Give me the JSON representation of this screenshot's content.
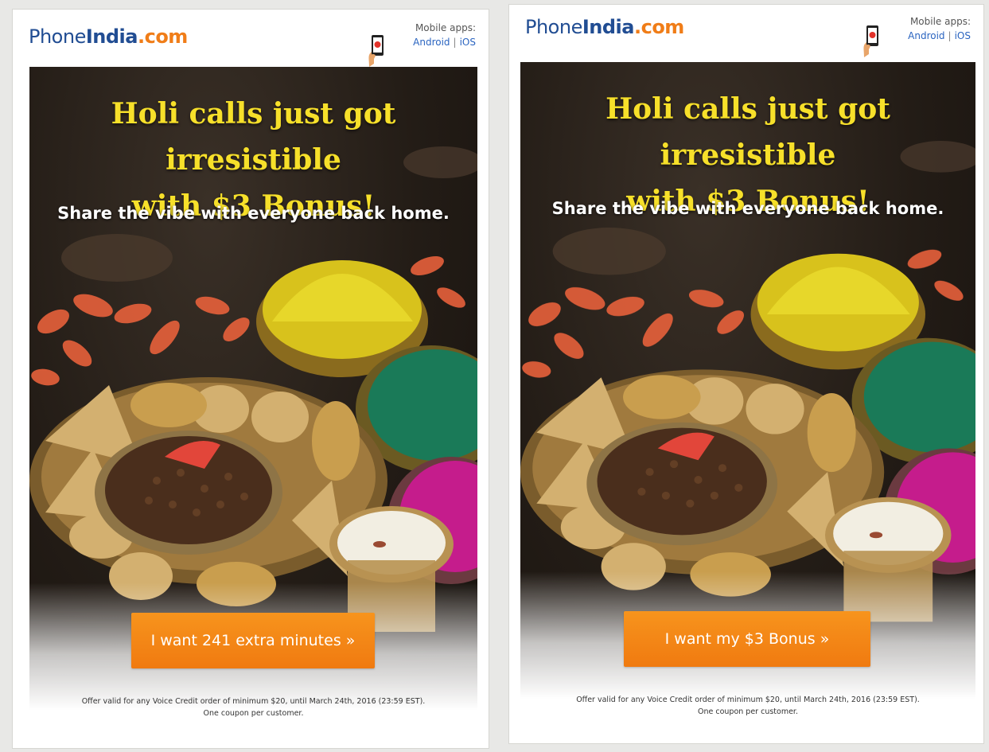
{
  "emails": [
    {
      "logo": {
        "part1": "Phone",
        "part2": "India",
        "tld": ".com"
      },
      "apps": {
        "label": "Mobile apps:",
        "android": "Android",
        "separator": "|",
        "ios": "iOS"
      },
      "headline_line1": "Holi calls just got irresistible",
      "headline_line2": "with $3 Bonus!",
      "subhead": "Share the vibe with everyone back home.",
      "cta": "I want 241 extra minutes »",
      "offer_line1": "Offer valid for any Voice Credit order of minimum $20, until March 24th, 2016 (23:59 EST).",
      "offer_line2": "One coupon per customer."
    },
    {
      "logo": {
        "part1": "Phone",
        "part2": "India",
        "tld": ".com"
      },
      "apps": {
        "label": "Mobile apps:",
        "android": "Android",
        "separator": "|",
        "ios": "iOS"
      },
      "headline_line1": "Holi calls just got irresistible",
      "headline_line2": "with $3 Bonus!",
      "subhead": "Share the vibe with everyone back home.",
      "cta": "I want my $3 Bonus »",
      "offer_line1": "Offer valid for any Voice Credit order of minimum $20, until March 24th, 2016 (23:59 EST).",
      "offer_line2": "One coupon per customer."
    }
  ],
  "colors": {
    "logo_blue": "#214d93",
    "logo_orange": "#f07d18",
    "headline_yellow": "#f7e02a",
    "cta_orange": "#f7941d",
    "link_blue": "#2a64c0"
  }
}
